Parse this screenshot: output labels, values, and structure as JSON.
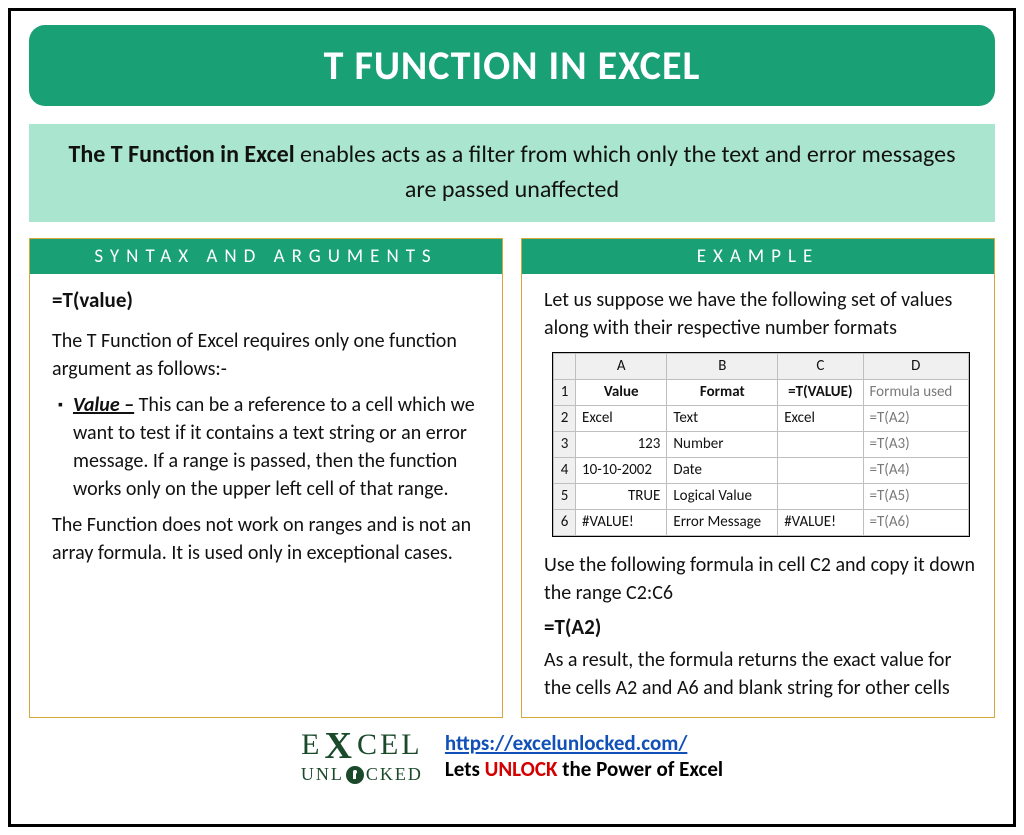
{
  "title": "T FUNCTION IN EXCEL",
  "description": {
    "bold": "The T Function in Excel",
    "rest": " enables acts as a filter from which only the text and error messages are passed unaffected"
  },
  "syntax": {
    "header": "SYNTAX AND ARGUMENTS",
    "formula": "=T(value)",
    "intro": "The T Function of Excel requires only one function argument as follows:-",
    "arg_name": "Value –",
    "arg_desc": " This can be a reference to a cell which we want to test if it contains a text string or an error message. If a range is passed, then the function works only on the upper left cell of that range.",
    "note": "The Function does not work on ranges and is not an array formula. It is used only in exceptional cases."
  },
  "example": {
    "header": "EXAMPLE",
    "intro": "Let us suppose we have the following set of values along with their respective number formats",
    "table": {
      "cols": [
        "A",
        "B",
        "C",
        "D"
      ],
      "headers": {
        "A": "Value",
        "B": "Format",
        "C": "=T(VALUE)",
        "D": "Formula used"
      },
      "rows": [
        {
          "n": "2",
          "A": "Excel",
          "A_align": "left",
          "B": "Text",
          "C": "Excel",
          "D": "=T(A2)"
        },
        {
          "n": "3",
          "A": "123",
          "A_align": "right",
          "B": "Number",
          "C": "",
          "D": "=T(A3)"
        },
        {
          "n": "4",
          "A": "10-10-2002",
          "A_align": "left",
          "B": "Date",
          "C": "",
          "D": "=T(A4)"
        },
        {
          "n": "5",
          "A": "TRUE",
          "A_align": "right",
          "B": "Logical Value",
          "C": "",
          "D": "=T(A5)"
        },
        {
          "n": "6",
          "A": "#VALUE!",
          "A_align": "left",
          "B": "Error Message",
          "C": "#VALUE!",
          "D": "=T(A6)"
        }
      ]
    },
    "use_note": "Use the following formula in cell C2 and copy it down the range C2:C6",
    "formula": "=T(A2)",
    "result": "As a result, the formula returns the exact value for the cells A2 and A6 and blank string for other cells"
  },
  "footer": {
    "logo_row1": "EXCEL",
    "logo_row2": "UNLOCKED",
    "url": "https://excelunlocked.com/",
    "tagline_pre": "Lets ",
    "tagline_mid": "UNLOCK",
    "tagline_post": " the Power of Excel"
  }
}
